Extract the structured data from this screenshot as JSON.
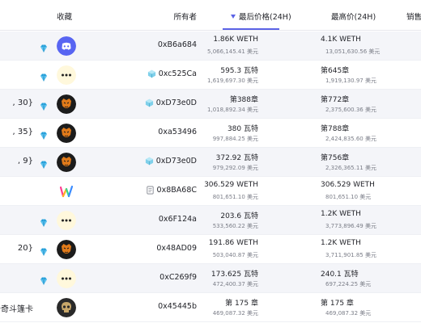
{
  "header": {
    "collection": "收藏",
    "owner": "所有者",
    "last_price": "最后价格(24H)",
    "highest_price": "最高价(24H)",
    "sales": "销售"
  },
  "colors": {
    "accent": "#5b63e6",
    "gem": "#2fa8e0"
  },
  "rows": [
    {
      "name": "",
      "gem": true,
      "avatar": "discord-logo",
      "avatar_bg": "#5865f2",
      "owner_icon": "",
      "owner": "0xB6a684",
      "price": "1.86K WETH",
      "price_usd": "5,066,145.41 美元",
      "high": "4.1K WETH",
      "high_usd": "13,051,630.56 美元"
    },
    {
      "name": "",
      "gem": true,
      "avatar": "dots",
      "avatar_bg": "#fff8dc",
      "owner_icon": "diamond-cube-icon",
      "owner": "0xc525Ca",
      "price": "595.3 瓦特",
      "price_usd": "1,619,697.30 美元",
      "high": "第645章",
      "high_usd": "1,919,130.97 美元"
    },
    {
      "name": ", 30}",
      "gem": true,
      "avatar": "ape",
      "avatar_bg": "#1c1c1c",
      "owner_icon": "diamond-cube-icon",
      "owner": "0xD73e0D",
      "price": "第388章",
      "price_usd": "1,018,892.34 美元",
      "high": "第772章",
      "high_usd": "2,375,600.36 美元"
    },
    {
      "name": ", 35}",
      "gem": true,
      "avatar": "ape",
      "avatar_bg": "#1c1c1c",
      "owner_icon": "",
      "owner": "0xa53496",
      "price": "380 瓦特",
      "price_usd": "997,884.25 美元",
      "high": "第788章",
      "high_usd": "2,424,835.60 美元"
    },
    {
      "name": ", 9}",
      "gem": true,
      "avatar": "ape",
      "avatar_bg": "#1c1c1c",
      "owner_icon": "diamond-cube-icon",
      "owner": "0xD73e0D",
      "price": "372.92 瓦特",
      "price_usd": "979,292.09 美元",
      "high": "第756章",
      "high_usd": "2,326,365.11 美元"
    },
    {
      "name": "",
      "gem": false,
      "avatar": "colorful-w",
      "avatar_bg": "#ffffff",
      "owner_icon": "document-icon",
      "owner": "0x8BA68C",
      "price": "306.529 WETH",
      "price_usd": "801,651.10 美元",
      "high": "306.529 WETH",
      "high_usd": "801,651.10 美元"
    },
    {
      "name": "",
      "gem": true,
      "avatar": "dots",
      "avatar_bg": "#fff8dc",
      "owner_icon": "",
      "owner": "0x6F124a",
      "price": "203.6 瓦特",
      "price_usd": "533,560.22 美元",
      "high": "1.2K WETH",
      "high_usd": "3,773,896.49 美元"
    },
    {
      "name": "20}",
      "gem": true,
      "avatar": "ape",
      "avatar_bg": "#1c1c1c",
      "owner_icon": "",
      "owner": "0x48AD09",
      "price": "191.86 WETH",
      "price_usd": "503,040.87 美元",
      "high": "1.2K WETH",
      "high_usd": "3,711,901.85 美元"
    },
    {
      "name": "",
      "gem": true,
      "avatar": "dots",
      "avatar_bg": "#fff8dc",
      "owner_icon": "",
      "owner": "0xC269f9",
      "price": "173.625 瓦特",
      "price_usd": "472,400.37 美元",
      "high": "240.1 瓦特",
      "high_usd": "697,224.25 美元"
    },
    {
      "name": "卡奇斗篷卡",
      "gem": false,
      "avatar": "skull",
      "avatar_bg": "#2a2a2a",
      "owner_icon": "",
      "owner": "0x45445b",
      "price": "第 175 章",
      "price_usd": "469,087.32 美元",
      "high": "第 175 章",
      "high_usd": "469,087.32 美元"
    }
  ]
}
